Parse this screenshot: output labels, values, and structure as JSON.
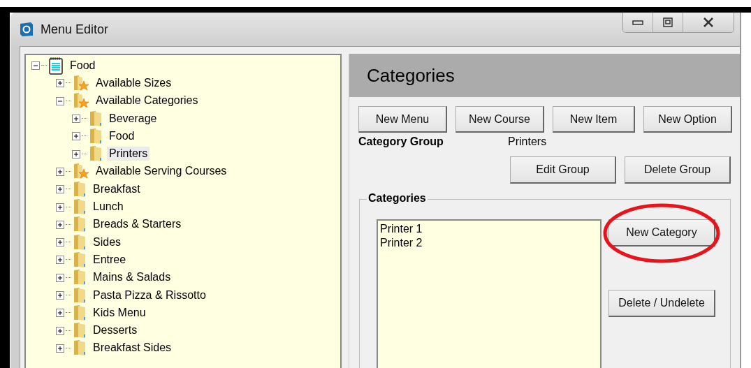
{
  "window": {
    "title": "Menu Editor"
  },
  "tree": [
    {
      "label": "Food",
      "kind": "notepad",
      "expanded": true,
      "selected": false,
      "children": [
        {
          "label": "Available Sizes",
          "kind": "starred",
          "expanded": false,
          "selected": false
        },
        {
          "label": "Available Categories",
          "kind": "starred",
          "expanded": true,
          "selected": false,
          "children": [
            {
              "label": "Beverage",
              "kind": "folder",
              "expanded": false,
              "selected": false
            },
            {
              "label": "Food",
              "kind": "folder",
              "expanded": false,
              "selected": false
            },
            {
              "label": "Printers",
              "kind": "folder",
              "expanded": false,
              "selected": true
            }
          ]
        },
        {
          "label": "Available Serving Courses",
          "kind": "starred",
          "expanded": false,
          "selected": false
        },
        {
          "label": "Breakfast",
          "kind": "folder",
          "expanded": false,
          "selected": false
        },
        {
          "label": "Lunch",
          "kind": "folder",
          "expanded": false,
          "selected": false
        },
        {
          "label": "Breads & Starters",
          "kind": "folder",
          "expanded": false,
          "selected": false
        },
        {
          "label": "Sides",
          "kind": "folder",
          "expanded": false,
          "selected": false
        },
        {
          "label": "Entree",
          "kind": "folder",
          "expanded": false,
          "selected": false
        },
        {
          "label": "Mains & Salads",
          "kind": "folder",
          "expanded": false,
          "selected": false
        },
        {
          "label": "Pasta Pizza & Rissotto",
          "kind": "folder",
          "expanded": false,
          "selected": false
        },
        {
          "label": "Kids Menu",
          "kind": "folder",
          "expanded": false,
          "selected": false
        },
        {
          "label": "Desserts",
          "kind": "folder",
          "expanded": false,
          "selected": false
        },
        {
          "label": "Breakfast Sides",
          "kind": "folder",
          "expanded": false,
          "selected": false
        }
      ]
    }
  ],
  "panel": {
    "title": "Categories",
    "top_buttons": [
      "New Menu",
      "New Course",
      "New Item",
      "New Option"
    ],
    "group_label": "Category Group",
    "group_value": "Printers",
    "group_buttons": [
      "Edit Group",
      "Delete Group"
    ],
    "categories_box": {
      "title": "Categories",
      "items": [
        "Printer 1",
        "Printer 2"
      ],
      "buttons": [
        {
          "label": "New Category",
          "circled": true
        },
        {
          "label": "Delete / Undelete",
          "circled": false
        }
      ]
    }
  }
}
